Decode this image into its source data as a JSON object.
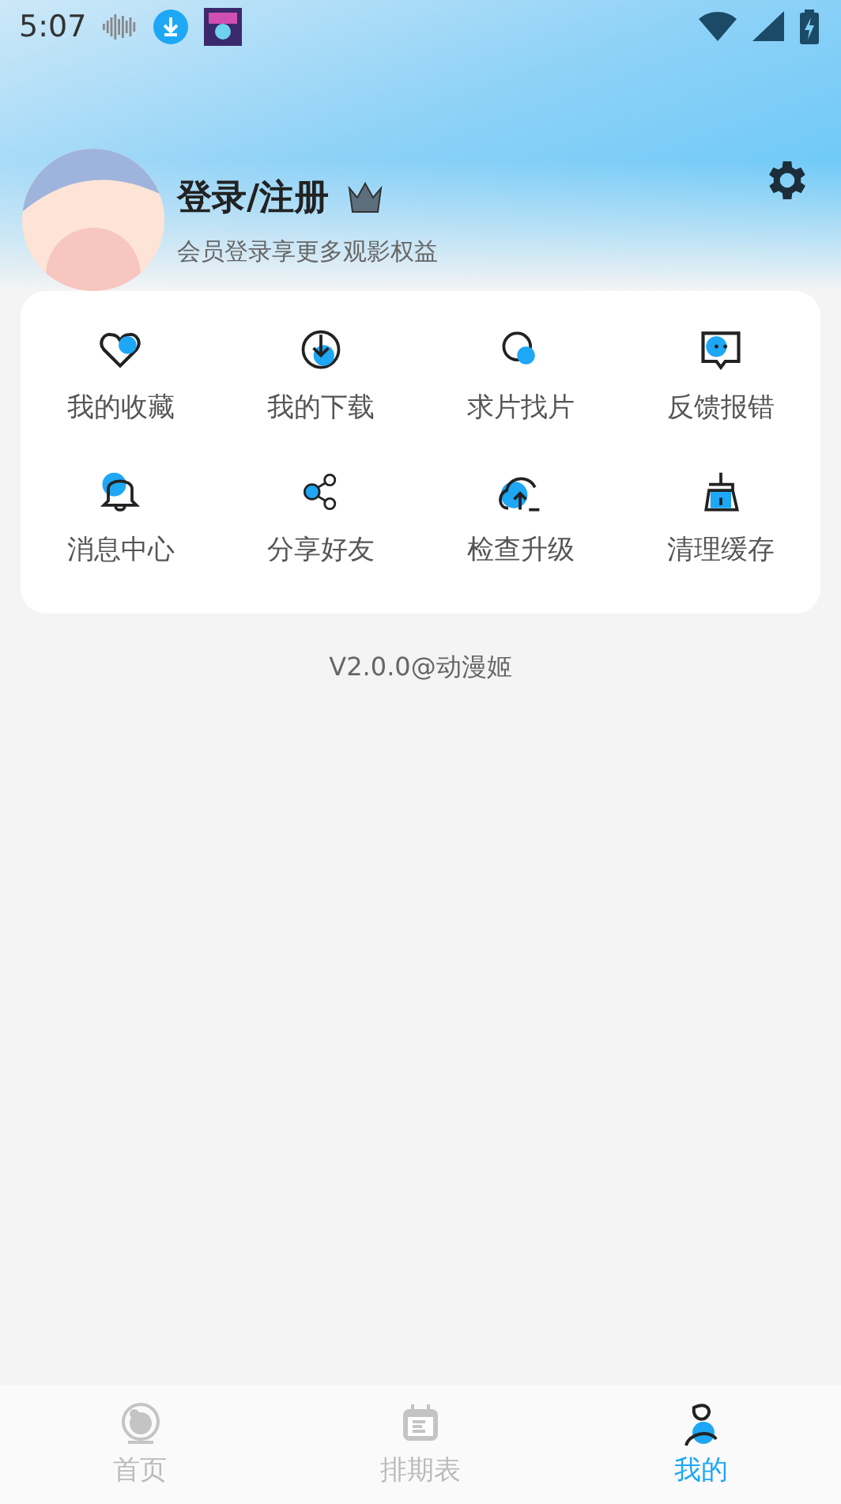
{
  "status_bar": {
    "time": "5:07"
  },
  "profile": {
    "title": "登录/注册",
    "subtitle": "会员登录享更多观影权益"
  },
  "menu": [
    {
      "label": "我的收藏"
    },
    {
      "label": "我的下载"
    },
    {
      "label": "求片找片"
    },
    {
      "label": "反馈报错"
    },
    {
      "label": "消息中心"
    },
    {
      "label": "分享好友"
    },
    {
      "label": "检查升级"
    },
    {
      "label": "清理缓存"
    }
  ],
  "version": "V2.0.0@动漫姬",
  "nav": [
    {
      "label": "首页",
      "selected": false
    },
    {
      "label": "排期表",
      "selected": false
    },
    {
      "label": "我的",
      "selected": true
    }
  ]
}
